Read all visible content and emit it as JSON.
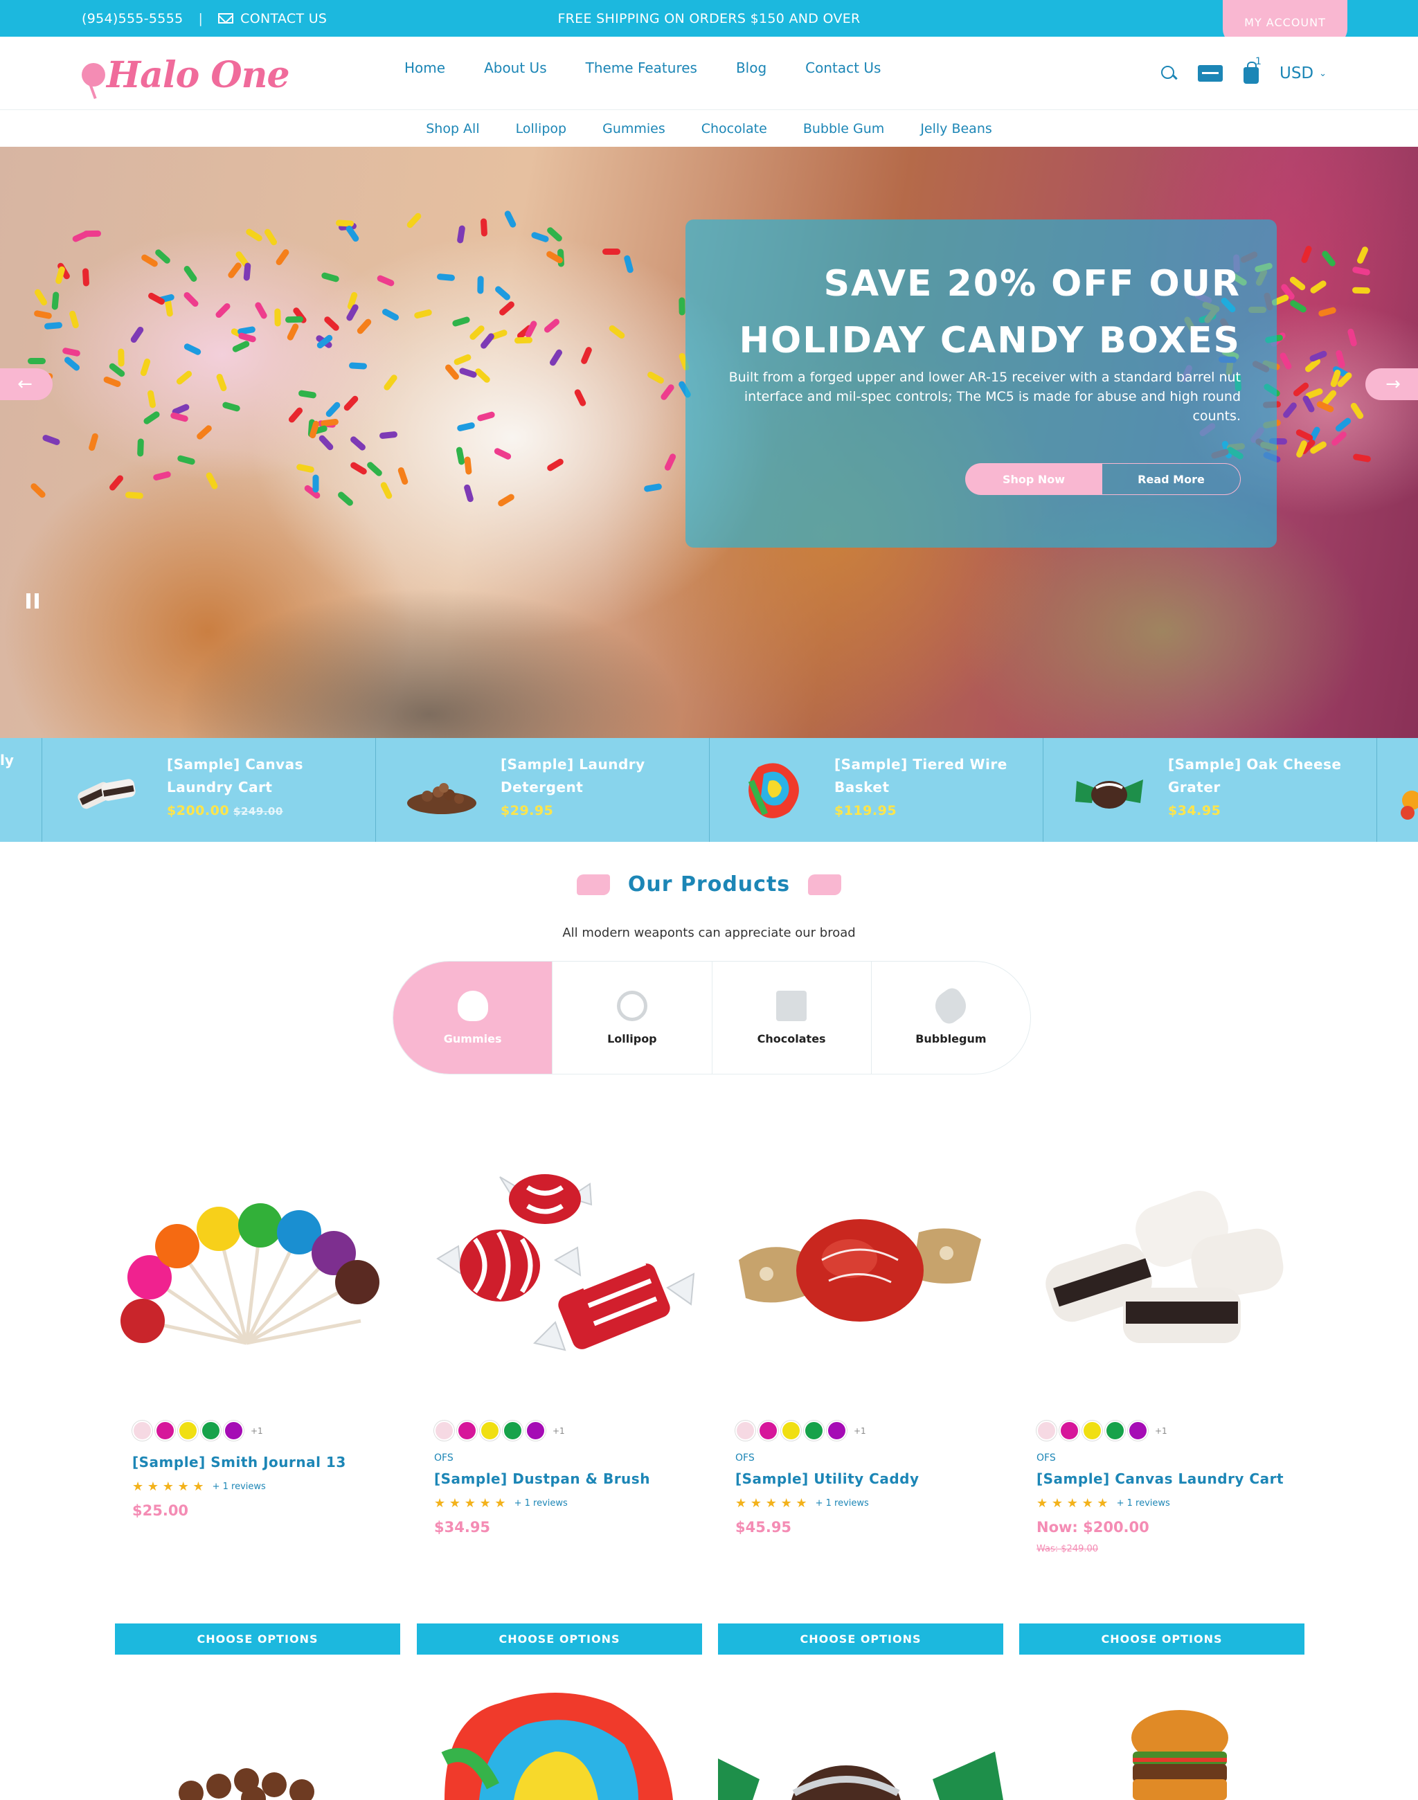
{
  "topbar": {
    "phone": "(954)555-5555",
    "separator": "|",
    "contact_label": "CONTACT US",
    "promo": "FREE SHIPPING ON ORDERS $150 AND OVER",
    "account_label": "MY ACCOUNT"
  },
  "header": {
    "logo_text": "Halo One",
    "nav": [
      "Home",
      "About Us",
      "Theme Features",
      "Blog",
      "Contact Us"
    ],
    "cart_count": "1",
    "currency": "USD"
  },
  "subnav": [
    "Shop All",
    "Lollipop",
    "Gummies",
    "Chocolate",
    "Bubble Gum",
    "Jelly Beans"
  ],
  "hero": {
    "title_line1": "SAVE 20% OFF OUR",
    "title_line2": "HOLIDAY CANDY BOXES",
    "text": "Built from a forged upper and lower AR-15 receiver with a standard barrel nut interface and mil-spec controls; The MC5 is made for abuse and high round counts.",
    "shop_label": "Shop Now",
    "read_label": "Read More",
    "prev_icon": "arrow-left-icon",
    "next_icon": "arrow-right-icon"
  },
  "strip": {
    "edge_text": "ly",
    "items": [
      {
        "name": "[Sample] Canvas Laundry Cart",
        "price": "$200.00",
        "was": "$249.00"
      },
      {
        "name": "[Sample] Laundry Detergent",
        "price": "$29.95",
        "was": ""
      },
      {
        "name": "[Sample] Tiered Wire Basket",
        "price": "$119.95",
        "was": ""
      },
      {
        "name": "[Sample] Oak Cheese Grater",
        "price": "$34.95",
        "was": ""
      }
    ]
  },
  "products_section": {
    "title": "Our Products",
    "subtitle": "All modern weaponts can appreciate our broad",
    "tabs": [
      "Gummies",
      "Lollipop",
      "Chocolates",
      "Bubblegum"
    ]
  },
  "products": [
    {
      "vendor": "",
      "name": "[Sample] Smith Journal 13",
      "stars": "★ ★ ★ ★ ★",
      "reviews": "+ 1 reviews",
      "price": "$25.00",
      "was": "",
      "swatch_more": "+1",
      "cta": "CHOOSE OPTIONS"
    },
    {
      "vendor": "OFS",
      "name": "[Sample] Dustpan & Brush",
      "stars": "★ ★ ★ ★ ★",
      "reviews": "+ 1 reviews",
      "price": "$34.95",
      "was": "",
      "swatch_more": "+1",
      "cta": "CHOOSE OPTIONS"
    },
    {
      "vendor": "OFS",
      "name": "[Sample] Utility Caddy",
      "stars": "★ ★ ★ ★ ★",
      "reviews": "+ 1 reviews",
      "price": "$45.95",
      "was": "",
      "swatch_more": "+1",
      "cta": "CHOOSE OPTIONS"
    },
    {
      "vendor": "OFS",
      "name": "[Sample] Canvas Laundry Cart",
      "stars": "★ ★ ★ ★ ★",
      "reviews": "+ 1 reviews",
      "price": "Now: $200.00",
      "was": "Was: $249.00",
      "swatch_more": "+1",
      "cta": "CHOOSE OPTIONS"
    }
  ],
  "swatch_colors": [
    "#f6d9e3",
    "#d6169a",
    "#f0df12",
    "#16a24a",
    "#a50bb5"
  ],
  "colors": {
    "accent": "#1cb8de",
    "pink": "#f9b7d1",
    "link": "#1c86b6",
    "price": "#f48cb4"
  }
}
